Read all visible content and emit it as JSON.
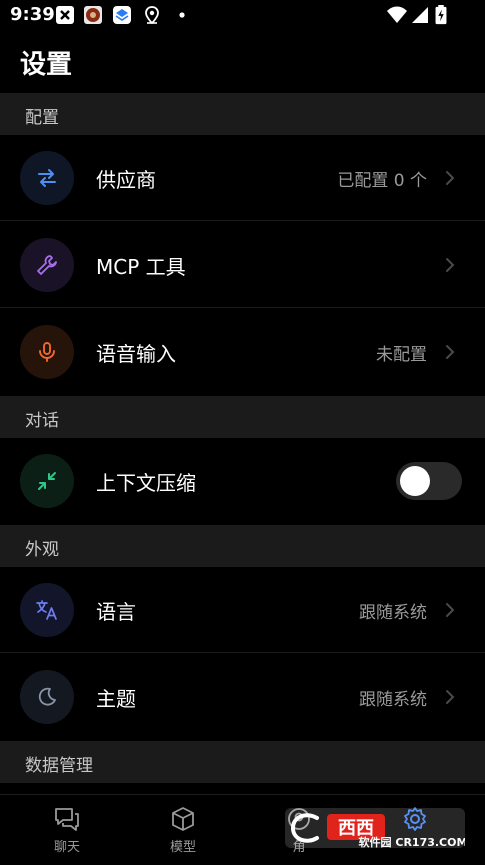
{
  "status_bar": {
    "time": "9:39"
  },
  "page": {
    "title": "设置"
  },
  "sections": {
    "config": {
      "title": "配置",
      "provider": {
        "label": "供应商",
        "value": "已配置 0 个",
        "icon": "arrows-swap-icon"
      },
      "mcp": {
        "label": "MCP 工具",
        "icon": "wrench-icon"
      },
      "voice": {
        "label": "语音输入",
        "value": "未配置",
        "icon": "microphone-icon"
      }
    },
    "chat": {
      "title": "对话",
      "compression": {
        "label": "上下文压缩",
        "enabled": false,
        "icon": "shrink-arrows-icon"
      }
    },
    "appearance": {
      "title": "外观",
      "language": {
        "label": "语言",
        "value": "跟随系统",
        "icon": "translate-icon"
      },
      "theme": {
        "label": "主题",
        "value": "跟随系统",
        "icon": "moon-icon"
      }
    },
    "data": {
      "title": "数据管理"
    }
  },
  "bottom_nav": {
    "chat": "聊天",
    "models": "模型",
    "third": "角",
    "settings_icon": "gear-icon"
  },
  "watermark": {
    "brand": "西西软件园",
    "site": "CR173.COM"
  },
  "colors": {
    "background": "#000000",
    "section_bg": "#1b1b1b",
    "provider_accent": "#4d8ff0",
    "mcp_accent": "#a86ef0",
    "voice_accent": "#f06a2a",
    "compress_accent": "#2ec98a",
    "language_accent": "#6e7cf0",
    "theme_accent": "#8a94a8",
    "settings_active": "#3d7ff0"
  }
}
